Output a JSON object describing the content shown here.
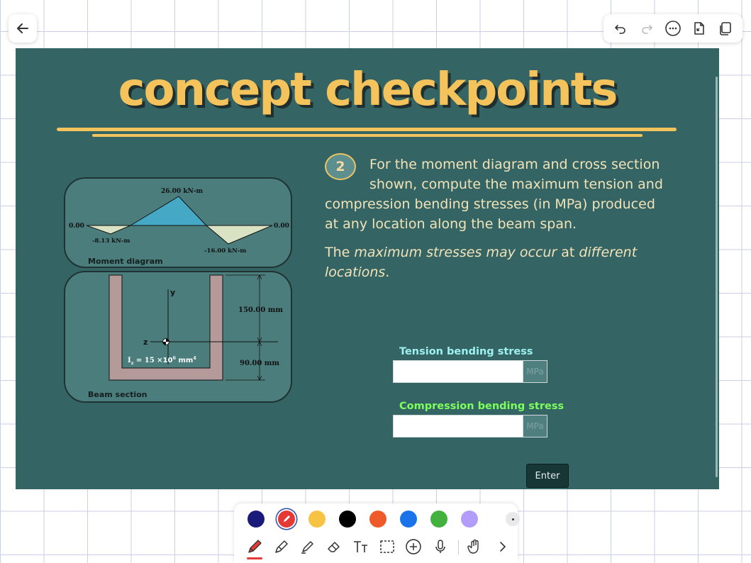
{
  "toolbar": {
    "back": "back-arrow-icon",
    "tools": [
      "undo-icon",
      "redo-icon",
      "more-icon",
      "export-icon",
      "copy-icon"
    ]
  },
  "slide": {
    "title": "concept checkpoints",
    "question_number": "2",
    "question_line1": "For the moment diagram and cross section",
    "question_line2": "shown, compute the maximum tension and",
    "question_line3": "compression bending stresses (in MPa) produced",
    "question_line4": "at any location along the beam span.",
    "note_part1": "The ",
    "note_part2": "maximum stresses may occur",
    "note_part3": " at ",
    "note_part4": "different",
    "note_part5": "locations",
    "note_part6": "."
  },
  "moment_diagram": {
    "label": "Moment diagram",
    "peak_label": "26.00 kN-m",
    "left_end": "0.00",
    "right_end": "0.00",
    "neg1_label": "-8.13 kN-m",
    "neg2_label": "-16.00 kN-m"
  },
  "beam_section": {
    "label": "Beam section",
    "axis_y": "y",
    "axis_z": "z",
    "dim_top": "150.00 mm",
    "dim_bottom": "90.00 mm",
    "inertia_prefix": "I",
    "inertia_sub": "z",
    "inertia_eq": " = 15 ×",
    "inertia_base": "10",
    "inertia_exp": "6",
    "inertia_unit": " mm",
    "inertia_unit_exp": "4"
  },
  "form": {
    "tension_label": "Tension bending stress",
    "tension_value": "",
    "tension_unit": "MPa",
    "compression_label": "Compression bending stress",
    "compression_value": "",
    "compression_unit": "MPa",
    "enter_label": "Enter"
  },
  "colors": {
    "slide_bg": "#356464",
    "title": "#f5c35c",
    "tension_label": "#9ff0f0",
    "compression_label": "#7cff5c",
    "swatches": [
      "#1a1a7a",
      "#e53935",
      "#f8c243",
      "#000000",
      "#ee5a2a",
      "#1a73e8",
      "#43b13d",
      "#b39dfb"
    ]
  },
  "drawing_tools": [
    "pen-icon",
    "marker-icon",
    "highlighter-icon",
    "eraser-icon",
    "text-tool-icon",
    "lasso-select-icon",
    "add-icon",
    "microphone-icon",
    "hand-icon",
    "chevron-right-icon"
  ]
}
